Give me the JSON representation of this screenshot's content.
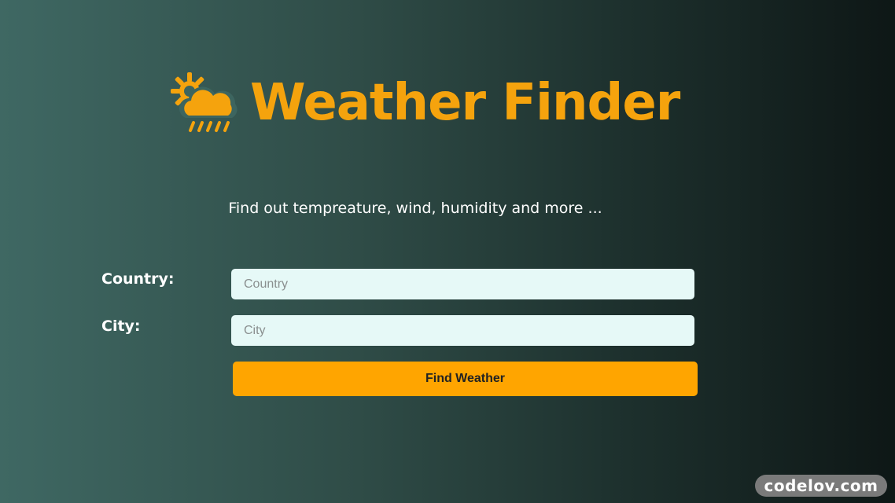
{
  "header": {
    "title": "Weather Finder",
    "icon": "weather-sun-cloud-rain-icon"
  },
  "subtitle": "Find out tempreature, wind, humidity and more ...",
  "form": {
    "country_label": "Country:",
    "country_placeholder": "Country",
    "country_value": "",
    "city_label": "City:",
    "city_placeholder": "City",
    "city_value": "",
    "submit_label": "Find Weather"
  },
  "watermark": "codelov.com",
  "colors": {
    "accent": "#ffa500",
    "title": "#f5a30d",
    "input_bg": "#e6f9f7",
    "bg_left": "#3f6863",
    "bg_right": "#0e1716"
  }
}
